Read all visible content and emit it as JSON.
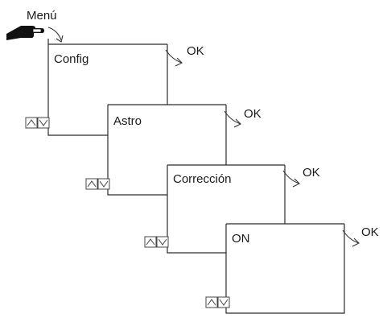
{
  "menu_label": "Menú",
  "ok_label": "OK",
  "steps": [
    {
      "label": "Config"
    },
    {
      "label": "Astro"
    },
    {
      "label": "Corrección"
    },
    {
      "label": "ON"
    }
  ],
  "icons": {
    "hand": "pointing-hand-icon",
    "curved_arrow": "curved-arrow-icon",
    "up_down": "up-down-buttons-icon"
  }
}
